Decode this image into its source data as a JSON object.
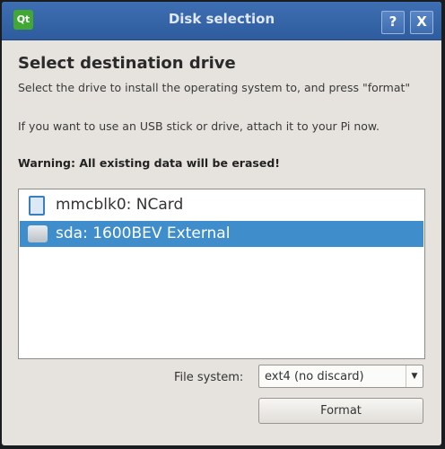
{
  "window": {
    "title": "Disk selection",
    "logo_text": "Qt",
    "help_label": "?",
    "close_label": "X"
  },
  "main": {
    "heading": "Select destination drive",
    "instruction": "Select the drive to install the operating system to, and press \"format\"",
    "usb_hint": "If you want to use an USB stick or drive, attach it to your Pi now.",
    "warning": "Warning: All existing data will be erased!"
  },
  "drives": [
    {
      "label": "mmcblk0: NCard",
      "icon": "sd-card-icon",
      "selected": false
    },
    {
      "label": "sda: 1600BEV External",
      "icon": "hard-disk-icon",
      "selected": true
    }
  ],
  "filesystem": {
    "label": "File system:",
    "value": "ext4 (no discard)"
  },
  "actions": {
    "format_label": "Format"
  },
  "colors": {
    "titlebar": "#2e5c9e",
    "selection": "#3f8ecb"
  }
}
